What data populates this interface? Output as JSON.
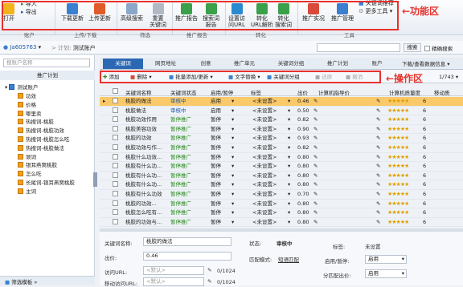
{
  "ribbon": {
    "open": "打开",
    "import": "导入",
    "export": "导出",
    "download_update": "下载更新",
    "upload_update": "上传更新",
    "adv_search": "高级搜索",
    "reset_kw": "重置\n关键词",
    "promo_report": "推广报告",
    "search_report": "搜索词\n报告",
    "set_url": "设置访\n问URL",
    "convert_url": "转化\nURL解析",
    "convert_search": "转化\n搜索词",
    "promo_practice": "推广实况",
    "promo_manage": "推广管理",
    "kw_recommend": "关键词推荐",
    "more_tools": "更多工具",
    "groups": {
      "account": "账户",
      "updown": "上传/下载",
      "filter": "筛选",
      "report": "推广报告",
      "convert": "转化",
      "tools": "工具"
    }
  },
  "annotations": {
    "func_area": "←功能区",
    "op_area": "←操作区"
  },
  "account_bar": {
    "user": "Ja605763",
    "plan": "计划:",
    "plan_name": "测试账户",
    "search_btn": "搜索",
    "exact_search": "精确搜索"
  },
  "sidebar": {
    "search_placeholder": "搜账户名称",
    "tab": "推广计划",
    "root": "测试账户",
    "items": [
      "功效",
      "价格",
      "哪里卖",
      "热搜词-桃胶",
      "热搜词-桃胶功效",
      "热搜词-桃胶怎么吃",
      "热搜词-桃胶做法",
      "顽词",
      "银耳燕窝桃胶",
      "怎么吃",
      "长尾词-银耳燕窝桃胶",
      "主词"
    ],
    "footer": "筛选模板"
  },
  "tabs": [
    "关键词",
    "网页地址",
    "创意",
    "推广单元",
    "关键词分组",
    "推广计划",
    "账户"
  ],
  "tab_right": "下载/查看数据信息",
  "toolbar": {
    "add": "添加",
    "delete": "删除",
    "batch": "批量添加/更新",
    "replace": "文字替换",
    "kw_group": "关键词分组",
    "restore": "还原",
    "undo": "撤消",
    "page": "1/743"
  },
  "columns": [
    "关键词名称",
    "关键词状态",
    "启用/暂停",
    "标签",
    "出价",
    "计算机指导价",
    "计算机质量度",
    "移动质"
  ],
  "rows": [
    {
      "kw": "桃胶的做法",
      "status": "审核中",
      "state": "启用",
      "tag": "<未设置>",
      "bid": "0.46",
      "q": "6"
    },
    {
      "kw": "桃胶做法",
      "status": "审核中",
      "state": "启用",
      "tag": "<未设置>",
      "bid": "0.50",
      "q": "6"
    },
    {
      "kw": "桃胶功效作用",
      "status": "暂停推广",
      "state": "暂停",
      "tag": "<未设置>",
      "bid": "0.82",
      "q": "6"
    },
    {
      "kw": "桃胶美容功效",
      "status": "暂停推广",
      "state": "暂停",
      "tag": "<未设置>",
      "bid": "0.90",
      "q": "6"
    },
    {
      "kw": "桃胶的功效",
      "status": "暂停推广",
      "state": "暂停",
      "tag": "<未设置>",
      "bid": "0.93",
      "q": "6"
    },
    {
      "kw": "桃胶功效与作...",
      "status": "暂停推广",
      "state": "暂停",
      "tag": "<未设置>",
      "bid": "0.82",
      "q": "6"
    },
    {
      "kw": "桃胶什么功效...",
      "status": "暂停推广",
      "state": "暂停",
      "tag": "<未设置>",
      "bid": "0.80",
      "q": "6"
    },
    {
      "kw": "桃胶有什么功...",
      "status": "暂停推广",
      "state": "暂停",
      "tag": "<未设置>",
      "bid": "0.80",
      "q": "6"
    },
    {
      "kw": "桃胶有什么功...",
      "status": "暂停推广",
      "state": "暂停",
      "tag": "<未设置>",
      "bid": "0.80",
      "q": "6"
    },
    {
      "kw": "桃胶有什么功...",
      "status": "暂停推广",
      "state": "暂停",
      "tag": "<未设置>",
      "bid": "0.80",
      "q": "6"
    },
    {
      "kw": "桃胶有什么功效",
      "status": "暂停推广",
      "state": "暂停",
      "tag": "<未设置>",
      "bid": "0.70",
      "q": "6"
    },
    {
      "kw": "桃胶的功效...",
      "status": "暂停推广",
      "state": "暂停",
      "tag": "<未设置>",
      "bid": "0.80",
      "q": "6"
    },
    {
      "kw": "桃胶怎么吃有...",
      "status": "暂停推广",
      "state": "暂停",
      "tag": "<未设置>",
      "bid": "0.80",
      "q": "6"
    },
    {
      "kw": "桃胶的功效与...",
      "status": "暂停推广",
      "state": "暂停",
      "tag": "<未设置>",
      "bid": "0.80",
      "q": "6"
    }
  ],
  "detail": {
    "kw_name_lbl": "关键词名称:",
    "kw_name": "桃胶的做法",
    "bid_lbl": "出价:",
    "bid": "0.46",
    "url_lbl": "访问URL:",
    "url_ph": "<默认>",
    "url_count": "0/1024",
    "murl_lbl": "移动访问URL:",
    "murl_ph": "<默认>",
    "murl_count": "0/1024",
    "status_lbl": "状态:",
    "status": "审核中",
    "match_lbl": "匹配模式:",
    "match": "短语匹配",
    "tag_lbl": "标签:",
    "tag": "未设置",
    "state_lbl": "启用/暂停:",
    "state": "启用",
    "device_lbl": "分匹配出价:",
    "device": "启用"
  }
}
